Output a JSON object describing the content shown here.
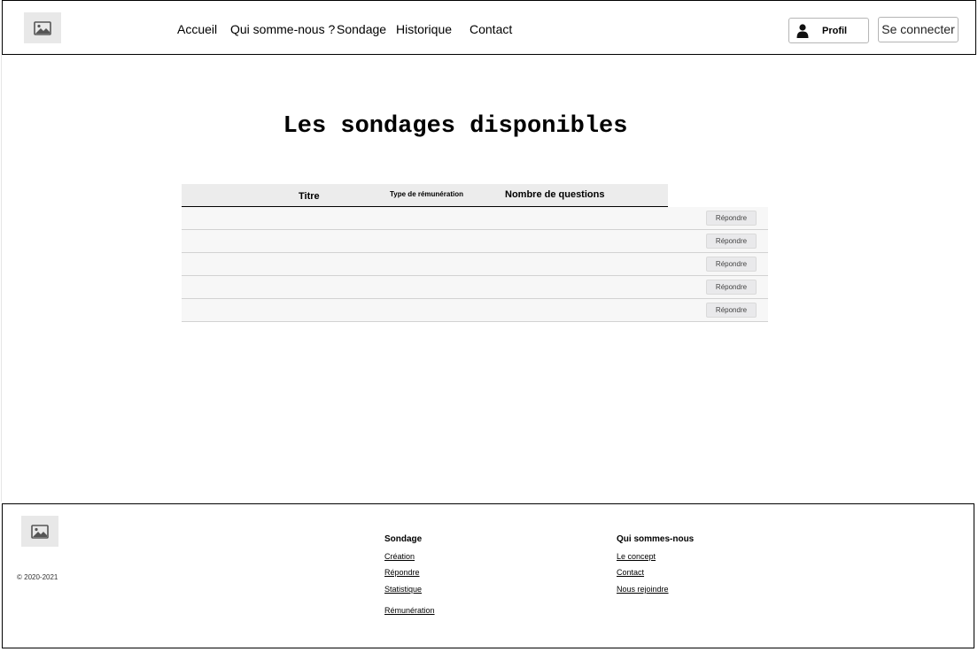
{
  "header": {
    "logo_icon": "image-icon",
    "nav": [
      "Accueil",
      "Qui somme-nous ?",
      "Sondage",
      "Historique",
      "Contact"
    ],
    "profile_icon": "user-icon",
    "profile_label": "Profil",
    "connect_label": "Se connecter"
  },
  "main": {
    "title": "Les sondages disponibles",
    "table": {
      "columns": [
        "Titre",
        "Type de rémunération",
        "Nombre de questions"
      ],
      "rows": [
        {
          "action": "Répondre"
        },
        {
          "action": "Répondre"
        },
        {
          "action": "Répondre"
        },
        {
          "action": "Répondre"
        },
        {
          "action": "Répondre"
        }
      ]
    }
  },
  "footer": {
    "logo_icon": "image-icon",
    "copyright": "© 2020-2021",
    "col1": {
      "title": "Sondage",
      "links": [
        "Création",
        "Répondre",
        "Statistique",
        "Rémunération"
      ]
    },
    "col2": {
      "title": "Qui sommes-nous",
      "links": [
        "Le concept",
        "Contact",
        "Nous rejoindre"
      ]
    }
  }
}
